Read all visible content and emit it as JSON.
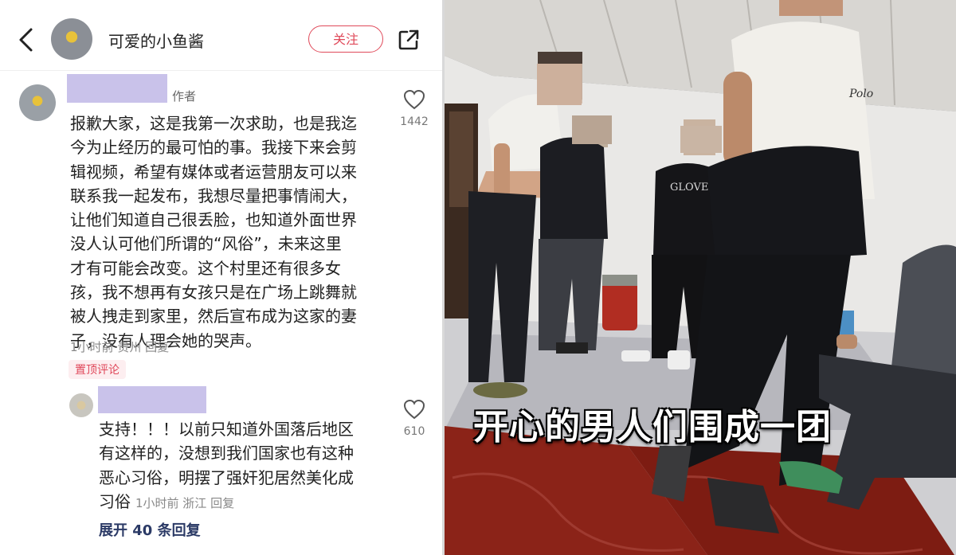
{
  "header": {
    "title": "可爱的小鱼酱",
    "follow_label": "关注"
  },
  "comments": [
    {
      "author_tag": "作者",
      "text_lines": [
        "报歉大家，这是我第一次求助，也是我迄",
        "今为止经历的最可怕的事。我接下来会剪",
        "辑视频，希望有媒体或者运营朋友可以来",
        "联系我一起发布，我想尽量把事情闹大，",
        "让他们知道自己很丢脸，也知道外面世界",
        "没人认可他们所谓的“风俗”，未来这里",
        "才有可能会改变。这个村里还有很多女",
        "孩，我不想再有女孩只是在广场上跳舞就",
        "被人拽走到家里，然后宣布成为这家的妻",
        "子，没有人理会她的哭声。"
      ],
      "meta": "1小时前  贵州  回复",
      "likes": "1442",
      "pinned_label": "置顶评论"
    },
    {
      "text_lines": [
        "支持！！！以前只知道外国落后地区",
        "有这样的，没想到我们国家也有这种",
        "恶心习俗，明摆了强奸犯居然美化成",
        "习俗"
      ],
      "meta": "1小时前  浙江  回复",
      "likes": "610"
    }
  ],
  "expand_label": "展开 40 条回复",
  "video": {
    "subtitle": "开心的男人们围成一团",
    "shirt_text_1": "GLOVE",
    "shirt_text_2": "Polo"
  },
  "icons": [
    "back-arrow-icon",
    "share-icon",
    "heart-icon"
  ]
}
